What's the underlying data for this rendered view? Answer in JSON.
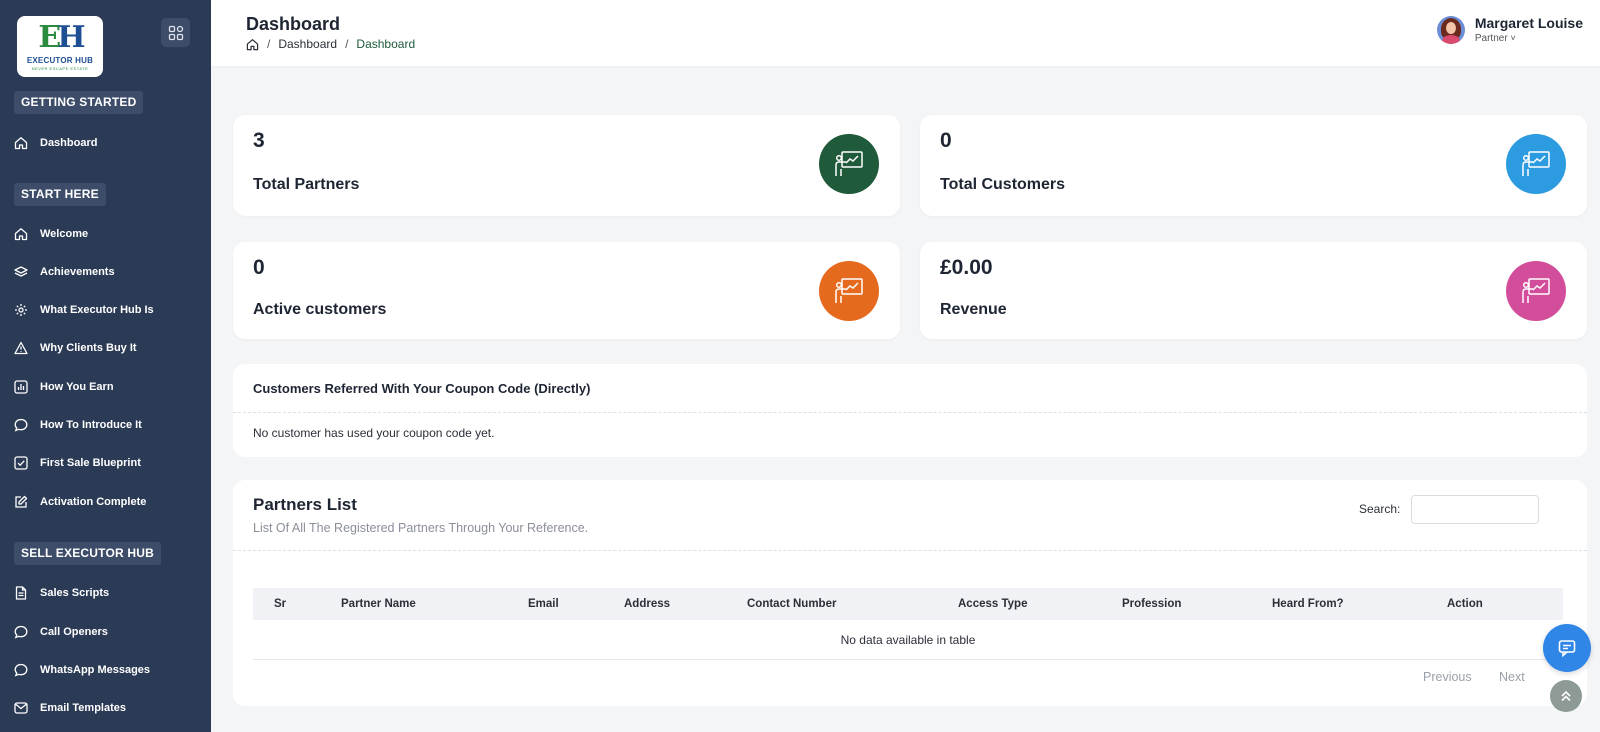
{
  "brand": {
    "logo_mark_left": "E",
    "logo_mark_right": "H",
    "logo_text": "EXECUTOR HUB",
    "logo_sub": "NEVER ESCAPE ESTATE"
  },
  "sidebar": {
    "sections": [
      {
        "label": "GETTING STARTED"
      },
      {
        "label": "START HERE"
      },
      {
        "label": "SELL EXECUTOR HUB"
      }
    ],
    "items": [
      {
        "label": "Dashboard",
        "icon": "home-icon"
      },
      {
        "label": "Welcome",
        "icon": "home-icon"
      },
      {
        "label": "Achievements",
        "icon": "layers-icon"
      },
      {
        "label": "What Executor Hub Is",
        "icon": "gear-icon"
      },
      {
        "label": "Why Clients Buy It",
        "icon": "warning-icon"
      },
      {
        "label": "How You Earn",
        "icon": "bar-chart-icon"
      },
      {
        "label": "How To Introduce It",
        "icon": "chat-bubble-icon"
      },
      {
        "label": "First Sale Blueprint",
        "icon": "check-square-icon"
      },
      {
        "label": "Activation Complete",
        "icon": "edit-icon"
      },
      {
        "label": "Sales Scripts",
        "icon": "document-icon"
      },
      {
        "label": "Call Openers",
        "icon": "chat-bubble-icon"
      },
      {
        "label": "WhatsApp Messages",
        "icon": "chat-bubble-icon"
      },
      {
        "label": "Email Templates",
        "icon": "mail-icon"
      }
    ]
  },
  "header": {
    "title": "Dashboard",
    "breadcrumb": [
      "Dashboard",
      "Dashboard"
    ],
    "breadcrumb_sep": "/",
    "user_name": "Margaret Louise",
    "user_role": "Partner",
    "user_role_caret": "˅"
  },
  "stats": [
    {
      "value": "3",
      "label": "Total Partners",
      "color": "#1f5a3a"
    },
    {
      "value": "0",
      "label": "Total Customers",
      "color": "#2d9be0"
    },
    {
      "value": "0",
      "label": "Active customers",
      "color": "#e56a1e"
    },
    {
      "value": "£0.00",
      "label": "Revenue",
      "color": "#d24d9a"
    }
  ],
  "referred": {
    "title": "Customers Referred With Your Coupon Code (Directly)",
    "empty": "No customer has used your coupon code yet."
  },
  "partners": {
    "title": "Partners List",
    "subtitle": "List Of All The Registered Partners Through Your Reference.",
    "search_label": "Search:",
    "search_value": "",
    "columns": [
      "Sr",
      "Partner Name",
      "Email",
      "Address",
      "Contact Number",
      "Access Type",
      "Profession",
      "Heard From?",
      "Action"
    ],
    "empty": "No data available in table",
    "prev_label": "Previous",
    "next_label": "Next"
  },
  "colors": {
    "sidebar_bg": "#2b3a55",
    "chat_fab": "#2f86e6",
    "breadcrumb_active": "#1f5b3a"
  }
}
